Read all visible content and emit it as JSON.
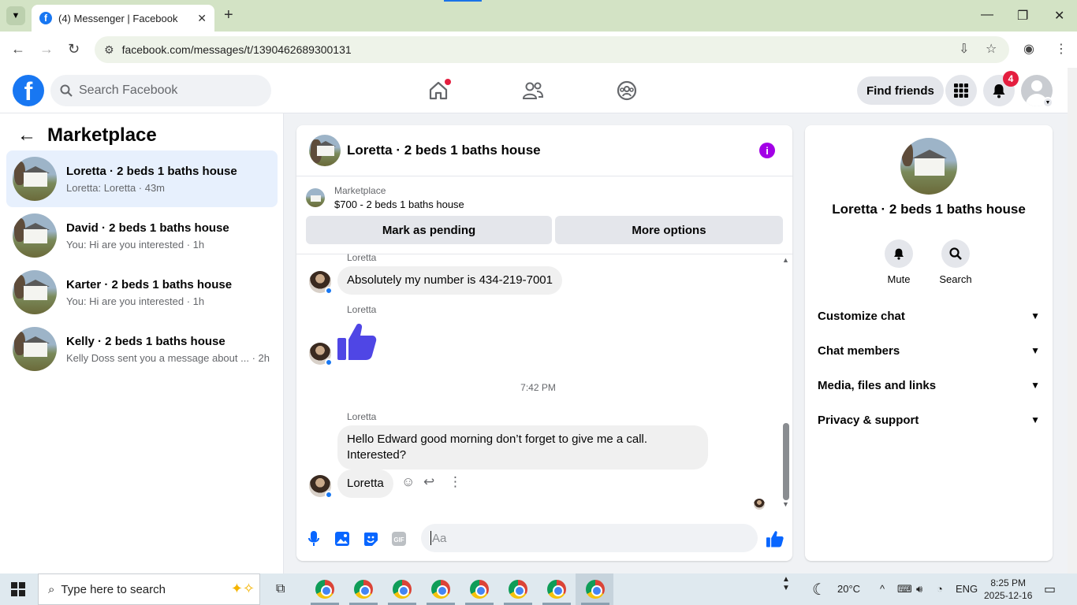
{
  "browser": {
    "tab_title": "(4) Messenger | Facebook",
    "url": "facebook.com/messages/t/1390462689300131"
  },
  "fb": {
    "search_placeholder": "Search Facebook",
    "find_friends": "Find friends",
    "notification_count": "4"
  },
  "sidebar": {
    "title": "Marketplace",
    "conversations": [
      {
        "name": "Loretta · 2 beds 1 baths house",
        "preview": "Loretta: Loretta · 43m"
      },
      {
        "name": "David · 2 beds 1 baths house",
        "preview": "You: Hi are you interested · 1h"
      },
      {
        "name": "Karter · 2 beds 1 baths house",
        "preview": "You: Hi are you interested · 1h"
      },
      {
        "name": "Kelly · 2 beds 1 baths house",
        "preview": "Kelly Doss sent you a message about ... · 2h"
      }
    ]
  },
  "chat": {
    "title": "Loretta · 2 beds 1 baths house",
    "marketplace_label": "Marketplace",
    "listing": "$700 - 2 beds 1 baths house",
    "mark_pending": "Mark as pending",
    "more_options": "More options",
    "messages": [
      {
        "sender": "Loretta",
        "text": "Absolutely my number is 434-219-7001"
      },
      {
        "sender": "Loretta",
        "text": ""
      },
      {
        "sender": "Loretta",
        "text": "Hello Edward good morning don’t forget to give me a call. Interested?"
      },
      {
        "sender": "",
        "text": "Loretta"
      }
    ],
    "timestamp": "7:42 PM",
    "composer_placeholder": "Aa"
  },
  "details": {
    "name": "Loretta · 2 beds 1 baths house",
    "mute": "Mute",
    "search": "Search",
    "sections": [
      "Customize chat",
      "Chat members",
      "Media, files and links",
      "Privacy & support"
    ]
  },
  "taskbar": {
    "search_placeholder": "Type here to search",
    "temperature": "20°C",
    "lang": "ENG",
    "time": "8:25 PM",
    "date": "2025-12-16"
  },
  "colors": {
    "fb_blue": "#1877f2",
    "messenger_blue": "#0866ff",
    "info_purple": "#a200e6",
    "notification_red": "#e41e3f"
  }
}
